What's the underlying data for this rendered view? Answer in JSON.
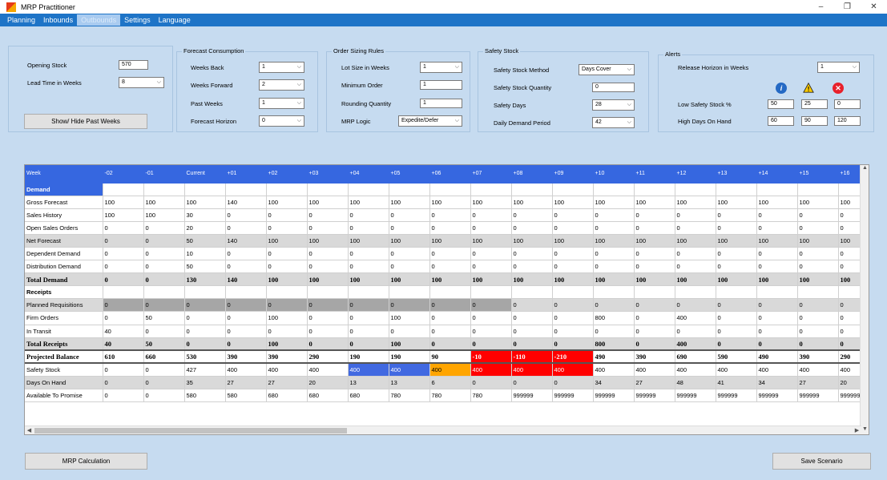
{
  "window": {
    "title": "MRP Practitioner",
    "minimize": "–",
    "restore": "❐",
    "close": "✕"
  },
  "menu": [
    "Planning",
    "Inbounds",
    "Outbounds",
    "Settings",
    "Language"
  ],
  "opening": {
    "opening_stock_label": "Opening Stock",
    "opening_stock": "570",
    "lead_time_label": "Lead Time in Weeks",
    "lead_time": "8",
    "show_hide_button": "Show/ Hide Past Weeks"
  },
  "forecast": {
    "title": "Forecast Consumption",
    "weeks_back_label": "Weeks Back",
    "weeks_back": "1",
    "weeks_forward_label": "Weeks Forward",
    "weeks_forward": "2",
    "past_weeks_label": "Past Weeks",
    "past_weeks": "1",
    "horizon_label": "Forecast Horizon",
    "horizon": "0"
  },
  "sizing": {
    "title": "Order Sizing Rules",
    "lot_size_label": "Lot Size in Weeks",
    "lot_size": "1",
    "min_order_label": "Minimum Order",
    "min_order": "1",
    "rounding_label": "Rounding Quantity",
    "rounding": "1",
    "logic_label": "MRP Logic",
    "logic": "Expedite/Defer"
  },
  "safety": {
    "title": "Safety Stock",
    "method_label": "Safety Stock Method",
    "method": "Days Cover",
    "quantity_label": "Safety Stock Quantity",
    "quantity": "0",
    "days_label": "Safety Days",
    "days": "28",
    "period_label": "Daily Demand Period",
    "period": "42"
  },
  "alerts": {
    "title": "Alerts",
    "release_label": "Release Horizon in Weeks",
    "release": "1",
    "low_label": "Low Safety Stock %",
    "low_values": [
      "50",
      "25",
      "0"
    ],
    "high_label": "High Days On Hand",
    "high_values": [
      "60",
      "90",
      "120"
    ],
    "icons": [
      "info-icon",
      "warning-icon",
      "error-icon"
    ]
  },
  "colors": {
    "header_blue": "#3667e0",
    "alert_blue": "#4169e1",
    "alert_orange": "#ffa500",
    "alert_red": "#ff0000"
  },
  "grid": {
    "header": [
      "Week",
      "-02",
      "-01",
      "Current",
      "+01",
      "+02",
      "+03",
      "+04",
      "+05",
      "+06",
      "+07",
      "+08",
      "+09",
      "+10",
      "+11",
      "+12",
      "+13",
      "+14",
      "+15",
      "+16"
    ],
    "rows": [
      {
        "label": "Demand",
        "values": [
          "",
          "",
          "",
          "",
          "",
          "",
          "",
          "",
          "",
          "",
          "",
          "",
          "",
          "",
          "",
          "",
          "",
          "",
          ""
        ]
      },
      {
        "label": "Gross Forecast",
        "values": [
          "100",
          "100",
          "100",
          "140",
          "100",
          "100",
          "100",
          "100",
          "100",
          "100",
          "100",
          "100",
          "100",
          "100",
          "100",
          "100",
          "100",
          "100",
          "100"
        ]
      },
      {
        "label": "Sales History",
        "values": [
          "100",
          "100",
          "30",
          "0",
          "0",
          "0",
          "0",
          "0",
          "0",
          "0",
          "0",
          "0",
          "0",
          "0",
          "0",
          "0",
          "0",
          "0",
          "0"
        ]
      },
      {
        "label": "Open Sales Orders",
        "values": [
          "0",
          "0",
          "20",
          "0",
          "0",
          "0",
          "0",
          "0",
          "0",
          "0",
          "0",
          "0",
          "0",
          "0",
          "0",
          "0",
          "0",
          "0",
          "0"
        ]
      },
      {
        "label": "Net Forecast",
        "values": [
          "0",
          "0",
          "50",
          "140",
          "100",
          "100",
          "100",
          "100",
          "100",
          "100",
          "100",
          "100",
          "100",
          "100",
          "100",
          "100",
          "100",
          "100",
          "100"
        ]
      },
      {
        "label": "Dependent Demand",
        "values": [
          "0",
          "0",
          "10",
          "0",
          "0",
          "0",
          "0",
          "0",
          "0",
          "0",
          "0",
          "0",
          "0",
          "0",
          "0",
          "0",
          "0",
          "0",
          "0"
        ]
      },
      {
        "label": "Distribution Demand",
        "values": [
          "0",
          "0",
          "50",
          "0",
          "0",
          "0",
          "0",
          "0",
          "0",
          "0",
          "0",
          "0",
          "0",
          "0",
          "0",
          "0",
          "0",
          "0",
          "0"
        ]
      },
      {
        "label": "Total Demand",
        "values": [
          "0",
          "0",
          "130",
          "140",
          "100",
          "100",
          "100",
          "100",
          "100",
          "100",
          "100",
          "100",
          "100",
          "100",
          "100",
          "100",
          "100",
          "100",
          "100"
        ]
      },
      {
        "label": "Receipts",
        "values": [
          "",
          "",
          "",
          "",
          "",
          "",
          "",
          "",
          "",
          "",
          "",
          "",
          "",
          "",
          "",
          "",
          "",
          "",
          ""
        ]
      },
      {
        "label": "Planned Requisitions",
        "values": [
          "0",
          "0",
          "0",
          "0",
          "0",
          "0",
          "0",
          "0",
          "0",
          "0",
          "0",
          "0",
          "0",
          "0",
          "0",
          "0",
          "0",
          "0",
          "0"
        ]
      },
      {
        "label": "Firm Orders",
        "values": [
          "0",
          "50",
          "0",
          "0",
          "100",
          "0",
          "0",
          "100",
          "0",
          "0",
          "0",
          "0",
          "800",
          "0",
          "400",
          "0",
          "0",
          "0",
          "0"
        ]
      },
      {
        "label": "In Transit",
        "values": [
          "40",
          "0",
          "0",
          "0",
          "0",
          "0",
          "0",
          "0",
          "0",
          "0",
          "0",
          "0",
          "0",
          "0",
          "0",
          "0",
          "0",
          "0",
          "0"
        ]
      },
      {
        "label": "Total Receipts",
        "values": [
          "40",
          "50",
          "0",
          "0",
          "100",
          "0",
          "0",
          "100",
          "0",
          "0",
          "0",
          "0",
          "800",
          "0",
          "400",
          "0",
          "0",
          "0",
          "0"
        ]
      },
      {
        "label": "Projected Balance",
        "values": [
          "610",
          "660",
          "530",
          "390",
          "390",
          "290",
          "190",
          "190",
          "90",
          "-10",
          "-110",
          "-210",
          "490",
          "390",
          "690",
          "590",
          "490",
          "390",
          "290"
        ]
      },
      {
        "label": "Safety Stock",
        "values": [
          "0",
          "0",
          "427",
          "400",
          "400",
          "400",
          "400",
          "400",
          "400",
          "400",
          "400",
          "400",
          "400",
          "400",
          "400",
          "400",
          "400",
          "400",
          "400"
        ]
      },
      {
        "label": "Days On Hand",
        "values": [
          "0",
          "0",
          "35",
          "27",
          "27",
          "20",
          "13",
          "13",
          "6",
          "0",
          "0",
          "0",
          "34",
          "27",
          "48",
          "41",
          "34",
          "27",
          "20"
        ]
      },
      {
        "label": "Available To Promise",
        "values": [
          "0",
          "0",
          "580",
          "580",
          "680",
          "680",
          "680",
          "780",
          "780",
          "780",
          "999999",
          "999999",
          "999999",
          "999999",
          "999999",
          "999999",
          "999999",
          "999999",
          "999999"
        ]
      }
    ]
  },
  "buttons": {
    "mrp_calculation": "MRP Calculation",
    "save_scenario": "Save Scenario"
  }
}
